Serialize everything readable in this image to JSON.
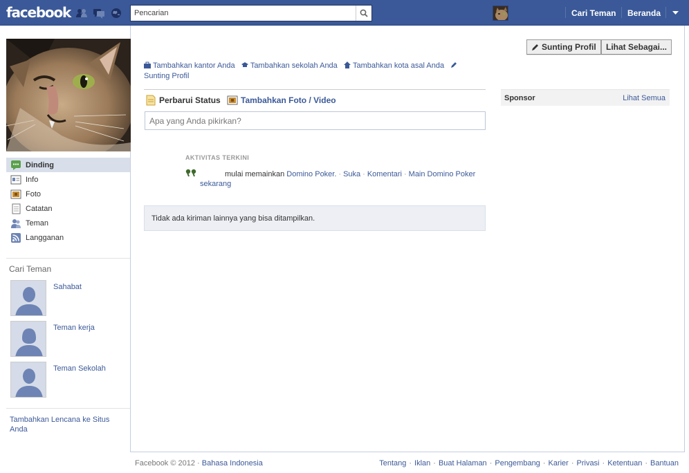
{
  "topbar": {
    "logo": "facebook",
    "search_placeholder": "Pencarian",
    "find_friends": "Cari Teman",
    "home": "Beranda"
  },
  "left_nav": {
    "items": [
      {
        "label": "Dinding",
        "icon": "wall-icon",
        "active": true
      },
      {
        "label": "Info",
        "icon": "info-icon"
      },
      {
        "label": "Foto",
        "icon": "photo-icon"
      },
      {
        "label": "Catatan",
        "icon": "notes-icon"
      },
      {
        "label": "Teman",
        "icon": "friends-icon"
      },
      {
        "label": "Langganan",
        "icon": "subscriptions-icon"
      }
    ]
  },
  "find_friends": {
    "title": "Cari Teman",
    "items": [
      {
        "label": "Sahabat"
      },
      {
        "label": "Teman kerja"
      },
      {
        "label": "Teman Sekolah"
      }
    ],
    "badge_link": "Tambahkan Lencana ke Situs Anda"
  },
  "profile_actions": {
    "edit_profile": "Sunting Profil",
    "view_as": "Lihat Sebagai..."
  },
  "info_links": {
    "work": "Tambahkan kantor Anda",
    "school": "Tambahkan sekolah Anda",
    "hometown": "Tambahkan kota asal Anda",
    "edit": "Sunting Profil"
  },
  "composer": {
    "status_tab": "Perbarui Status",
    "photo_tab": "Tambahkan Foto / Video",
    "placeholder": "Apa yang Anda pikirkan?"
  },
  "activity": {
    "title": "AKTIVITAS TERKINI",
    "text": "mulai memainkan",
    "game": "Domino Poker.",
    "like": "Suka",
    "comment": "Komentari",
    "play": "Main Domino Poker",
    "time": "sekarang"
  },
  "feed": {
    "no_posts": "Tidak ada kiriman lainnya yang bisa ditampilkan."
  },
  "sponsor": {
    "title": "Sponsor",
    "see_all": "Lihat Semua"
  },
  "footer": {
    "copyright": "Facebook © 2012 ·",
    "language": "Bahasa Indonesia",
    "links": [
      "Tentang",
      "Iklan",
      "Buat Halaman",
      "Pengembang",
      "Karier",
      "Privasi",
      "Ketentuan",
      "Bantuan"
    ]
  },
  "colors": {
    "brand_blue": "#3b5998",
    "active_nav": "#d8dfea",
    "feed_box": "#edeff4"
  }
}
